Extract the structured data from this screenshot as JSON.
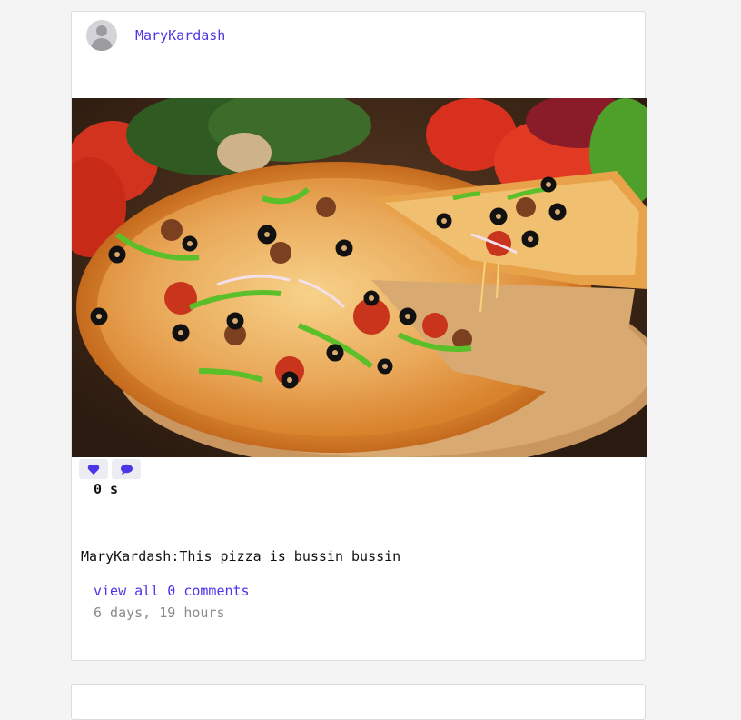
{
  "post": {
    "username": "MaryKardash",
    "likes_text": "0 s",
    "caption": "MaryKardash:This pizza is bussin bussin",
    "view_comments": "view all 0 comments",
    "timestamp": "6 days, 19 hours",
    "image_alt": "pizza",
    "icons": {
      "like": "heart-icon",
      "comment": "comment-bubble-icon"
    }
  },
  "colors": {
    "accent": "#4b35e8",
    "background": "#f4f4f4",
    "card": "#ffffff",
    "muted_text": "#8a8a8a"
  }
}
